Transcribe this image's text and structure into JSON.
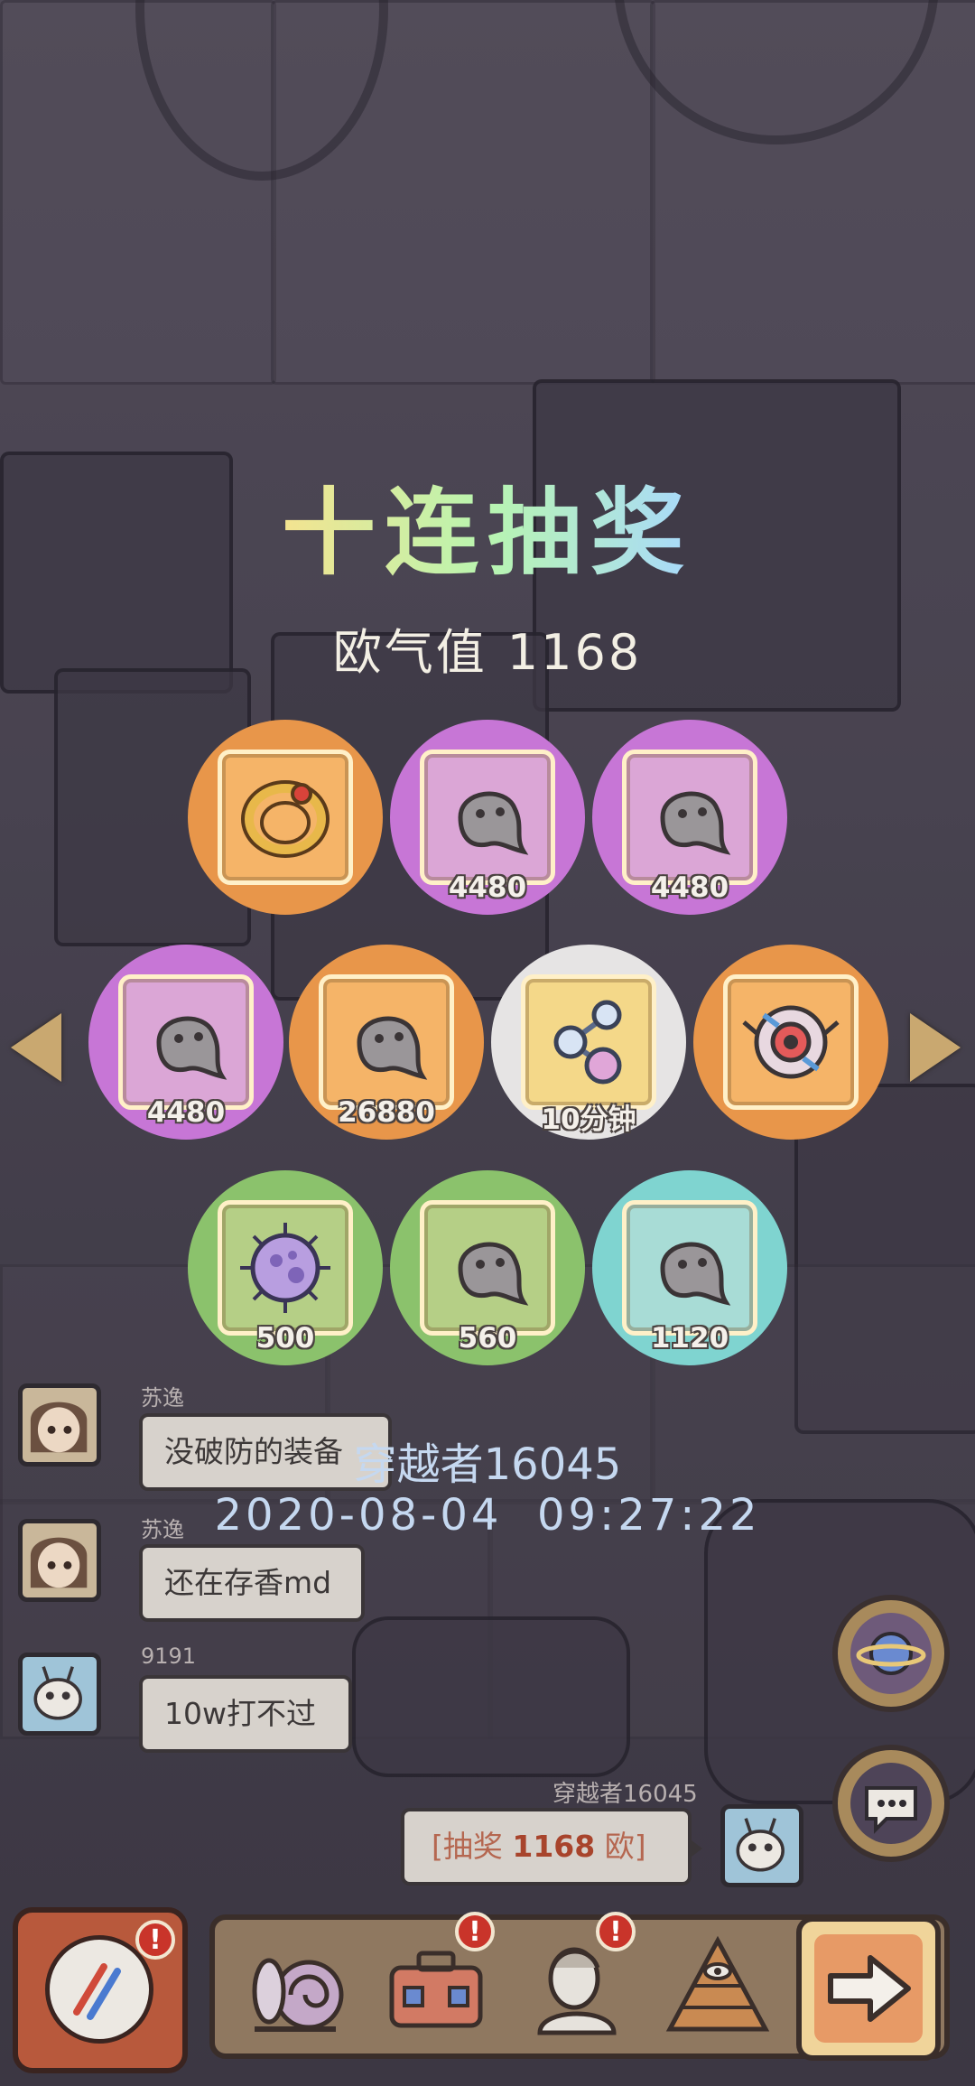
{
  "title": "十连抽奖",
  "luck": {
    "label": "欧气值",
    "value": "1168"
  },
  "rewards": [
    {
      "icon": "ring-icon",
      "rarity": "orange",
      "count": ""
    },
    {
      "icon": "blob-icon",
      "rarity": "purple",
      "count": "4480"
    },
    {
      "icon": "blob-icon",
      "rarity": "purple",
      "count": "4480"
    },
    {
      "icon": "blob-icon",
      "rarity": "purple",
      "count": "4480"
    },
    {
      "icon": "blob-icon",
      "rarity": "orange",
      "count": "26880"
    },
    {
      "icon": "molecule-icon",
      "rarity": "white",
      "count": "10分钟"
    },
    {
      "icon": "robot-eye-icon",
      "rarity": "orange",
      "count": ""
    },
    {
      "icon": "virus-icon",
      "rarity": "green",
      "count": "500"
    },
    {
      "icon": "blob-icon",
      "rarity": "green",
      "count": "560"
    },
    {
      "icon": "blob-icon",
      "rarity": "teal",
      "count": "1120"
    }
  ],
  "player": {
    "name": "穿越者16045",
    "datetime": "2020-08-04  09:27:22"
  },
  "chat": [
    {
      "name": "苏逸",
      "text": "没破防的装备"
    },
    {
      "name": "苏逸",
      "text": "还在存香md"
    },
    {
      "name": "9191",
      "text": "10w打不过"
    }
  ],
  "my_message": {
    "name": "穿越者16045",
    "prefix": "[抽奖 ",
    "amount": "1168",
    "suffix": " 欧]"
  },
  "badge_mark": "!",
  "colors": {
    "orange": "#e8964a",
    "purple": "#c776d6",
    "white": "#e6e4e4",
    "green": "#8bc26c",
    "teal": "#7fd4d0",
    "badge": "#c9342a"
  }
}
